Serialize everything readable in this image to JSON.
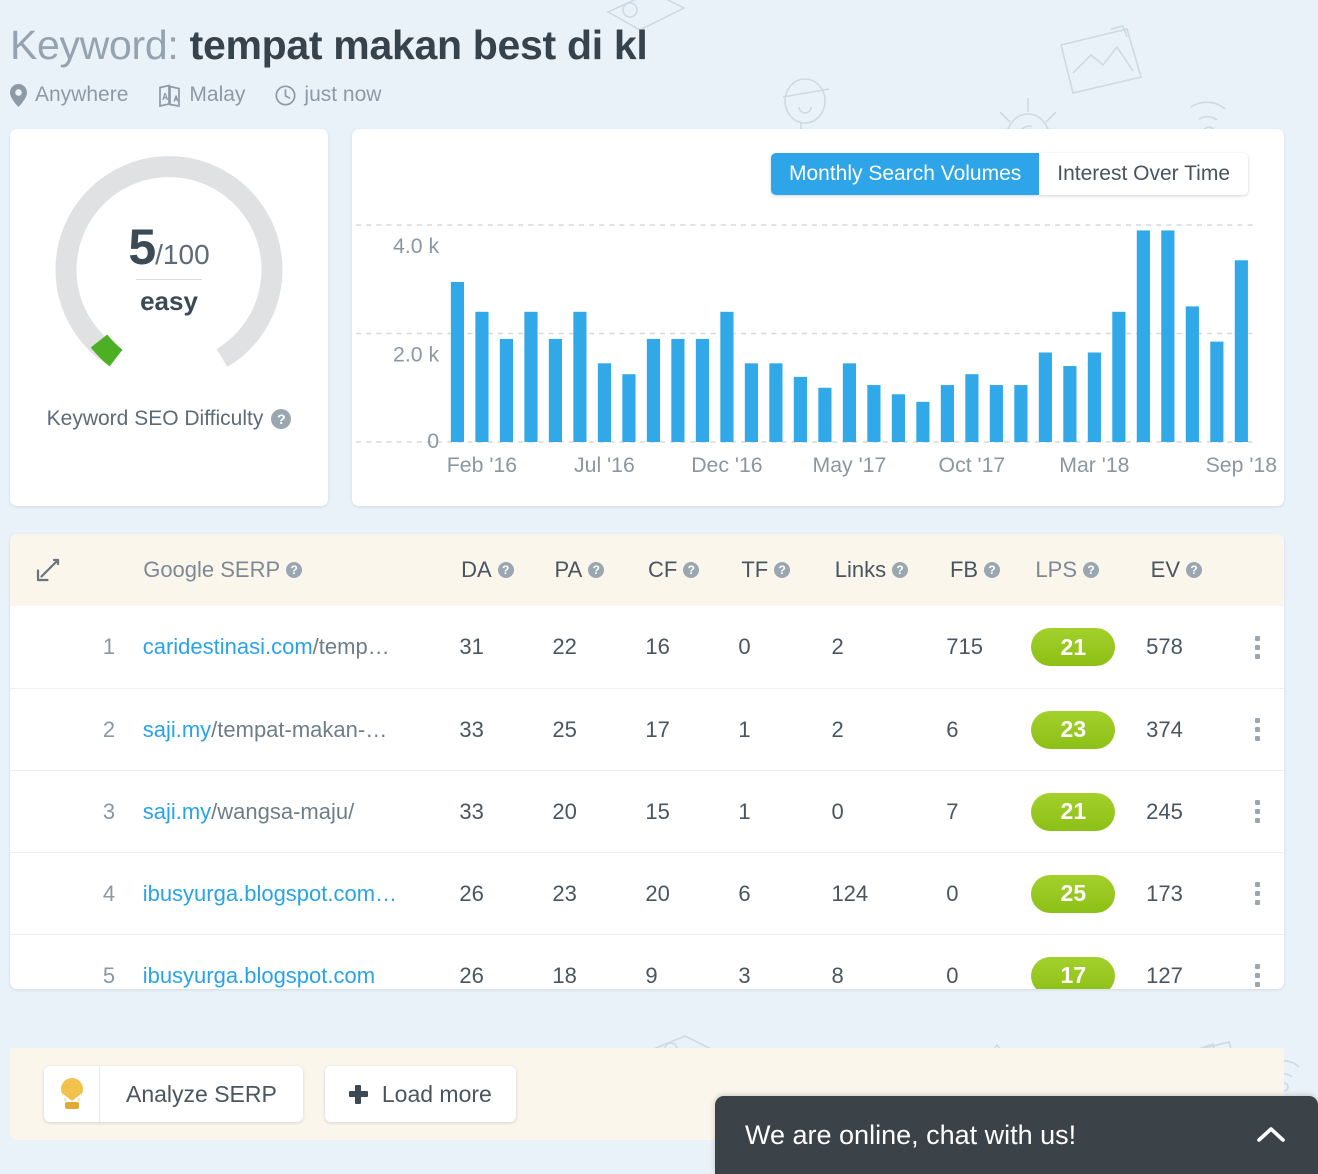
{
  "header": {
    "label": "Keyword:",
    "keyword": "tempat makan best di kl",
    "location": "Anywhere",
    "language": "Malay",
    "updated": "just now",
    "location_icon": "map-pin-icon",
    "language_icon": "translate-icon",
    "time_icon": "clock-icon"
  },
  "difficulty": {
    "score": "5",
    "out_of": "/100",
    "verdict": "easy",
    "caption": "Keyword SEO Difficulty",
    "help": "?",
    "track_color": "#e0e1e2",
    "value_color": "#4caf24",
    "percent": 5
  },
  "chart_card": {
    "tabs": [
      {
        "label": "Monthly Search Volumes",
        "active": true
      },
      {
        "label": "Interest Over Time",
        "active": false
      }
    ],
    "accent": "#2da5e8"
  },
  "chart_data": {
    "type": "bar",
    "title": "Monthly Search Volumes",
    "xlabel": "",
    "ylabel": "",
    "ylim": [
      0,
      4800
    ],
    "grid": true,
    "legend": "none",
    "bar_color": "#31a9e8",
    "ytick_labels": [
      "0",
      "2.0 k",
      "4.0 k"
    ],
    "ytick_values": [
      0,
      2000,
      4000
    ],
    "xtick_labels": [
      "Feb '16",
      "Jul '16",
      "Dec '16",
      "May '17",
      "Oct '17",
      "Mar '18",
      "Sep '18"
    ],
    "categories": [
      "Jan '16",
      "Feb '16",
      "Mar '16",
      "Apr '16",
      "May '16",
      "Jun '16",
      "Jul '16",
      "Aug '16",
      "Sep '16",
      "Oct '16",
      "Nov '16",
      "Dec '16",
      "Jan '17",
      "Feb '17",
      "Mar '17",
      "Apr '17",
      "May '17",
      "Jun '17",
      "Jul '17",
      "Aug '17",
      "Sep '17",
      "Oct '17",
      "Nov '17",
      "Dec '17",
      "Jan '18",
      "Feb '18",
      "Mar '18",
      "Apr '18",
      "May '18",
      "Jun '18",
      "Jul '18",
      "Aug '18",
      "Sep '18"
    ],
    "values": [
      2950,
      2400,
      1900,
      2400,
      1900,
      2400,
      1450,
      1250,
      1900,
      1900,
      1900,
      2400,
      1450,
      1450,
      1200,
      1000,
      1450,
      1050,
      880,
      740,
      1050,
      1250,
      1050,
      1050,
      1650,
      1400,
      1650,
      2400,
      3900,
      3900,
      2500,
      1850,
      3350
    ]
  },
  "serp_table": {
    "expand_icon": "expand-diagonal-icon",
    "columns": [
      {
        "key": "url",
        "label": "Google SERP",
        "help": "?"
      },
      {
        "key": "da",
        "label": "DA",
        "help": "?"
      },
      {
        "key": "pa",
        "label": "PA",
        "help": "?"
      },
      {
        "key": "cf",
        "label": "CF",
        "help": "?"
      },
      {
        "key": "tf",
        "label": "TF",
        "help": "?"
      },
      {
        "key": "links",
        "label": "Links",
        "help": "?"
      },
      {
        "key": "fb",
        "label": "FB",
        "help": "?"
      },
      {
        "key": "lps",
        "label": "LPS",
        "help": "?"
      },
      {
        "key": "ev",
        "label": "EV",
        "help": "?"
      }
    ],
    "rows": [
      {
        "rank": "1",
        "domain": "caridestinasi.com",
        "path": "/temp…",
        "da": "31",
        "pa": "22",
        "cf": "16",
        "tf": "0",
        "links": "2",
        "fb": "715",
        "lps": "21",
        "ev": "578"
      },
      {
        "rank": "2",
        "domain": "saji.my",
        "path": "/tempat-makan-…",
        "da": "33",
        "pa": "25",
        "cf": "17",
        "tf": "1",
        "links": "2",
        "fb": "6",
        "lps": "23",
        "ev": "374"
      },
      {
        "rank": "3",
        "domain": "saji.my",
        "path": "/wangsa-maju/",
        "da": "33",
        "pa": "20",
        "cf": "15",
        "tf": "1",
        "links": "0",
        "fb": "7",
        "lps": "21",
        "ev": "245"
      },
      {
        "rank": "4",
        "domain": "ibusyurga.blogspot.com…",
        "path": "",
        "da": "26",
        "pa": "23",
        "cf": "20",
        "tf": "6",
        "links": "124",
        "fb": "0",
        "lps": "25",
        "ev": "173"
      },
      {
        "rank": "5",
        "domain": "ibusyurga.blogspot.com",
        "path": "",
        "da": "26",
        "pa": "18",
        "cf": "9",
        "tf": "3",
        "links": "8",
        "fb": "0",
        "lps": "17",
        "ev": "127"
      }
    ],
    "row_menu_icon": "kebab-menu-icon"
  },
  "actions": {
    "analyze_label": "Analyze SERP",
    "analyze_icon": "serp-bulb-icon",
    "load_more_label": "Load more",
    "load_more_icon": "plus-icon"
  },
  "chat": {
    "message": "We are online, chat with us!",
    "collapse_icon": "chevron-up-icon"
  }
}
